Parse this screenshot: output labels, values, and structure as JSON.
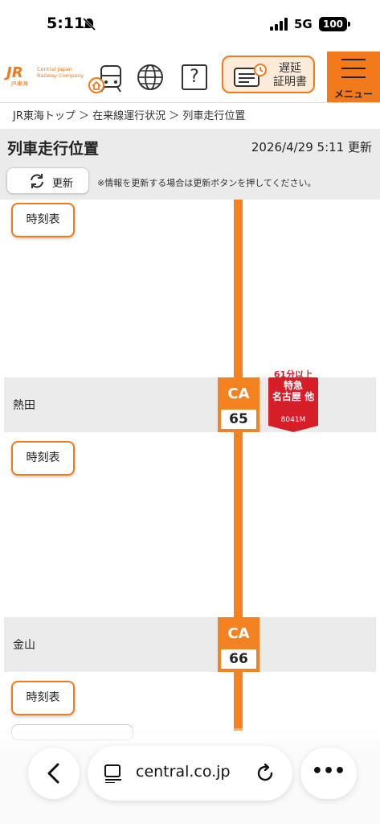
{
  "status_bar": {
    "time": "5:11",
    "network": "5G",
    "battery": "100"
  },
  "header": {
    "logo_mark": "JR",
    "logo_sub": "JR東海",
    "logo_text_line1": "Central Japan",
    "logo_text_line2": "Railway Company",
    "icons": [
      "home-train-icon",
      "globe-icon",
      "help-icon"
    ],
    "help_glyph": "?",
    "cert_label_line1": "遅延",
    "cert_label_line2": "証明書",
    "menu_label": "メニュー"
  },
  "breadcrumb": "JR東海トップ ＞ 在来線運行状況 ＞ 列車走行位置",
  "title_bar": {
    "title": "列車走行位置",
    "updated": "2026/4/29 5:11 更新",
    "refresh_label": "更新",
    "note": "※情報を更新する場合は更新ボタンを押してください。"
  },
  "timetable_label": "時刻表",
  "stations": [
    {
      "name": "熱田",
      "line_code": "CA",
      "number": "65"
    },
    {
      "name": "金山",
      "line_code": "CA",
      "number": "66"
    }
  ],
  "train": {
    "delay": "61分以上",
    "type": "特急",
    "destination": "名古屋 他",
    "number": "8041M"
  },
  "colors": {
    "accent": "#f58220",
    "delay_red": "#d61e29",
    "row_gray": "#ebebeb"
  },
  "browser": {
    "url": "central.co.jp",
    "more": "•••"
  }
}
